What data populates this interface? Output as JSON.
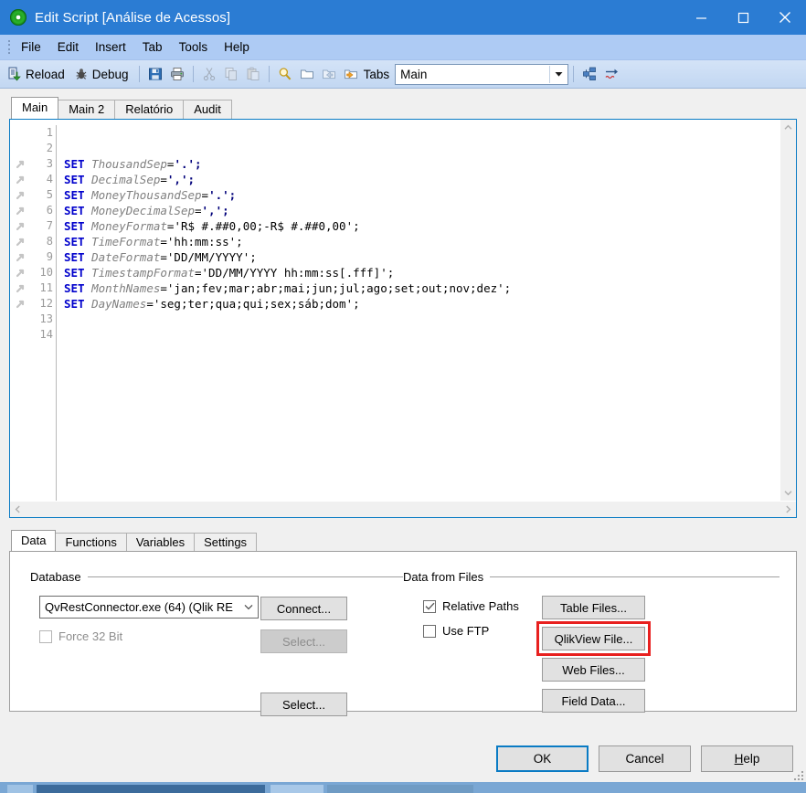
{
  "window": {
    "title": "Edit Script [Análise de Acessos]",
    "icon": "qlikview-logo-icon",
    "minimize_label": "Minimize",
    "maximize_label": "Maximize",
    "close_label": "Close"
  },
  "menubar": {
    "items": [
      {
        "label": "File"
      },
      {
        "label": "Edit"
      },
      {
        "label": "Insert"
      },
      {
        "label": "Tab"
      },
      {
        "label": "Tools"
      },
      {
        "label": "Help"
      }
    ]
  },
  "toolbar": {
    "reload_label": "Reload",
    "debug_label": "Debug",
    "tabs_label": "Tabs",
    "tab_combo_value": "Main",
    "icons": {
      "reload": "reload-icon",
      "debug": "debug-bug-icon",
      "save": "save-icon",
      "print": "print-icon",
      "cut": "cut-icon",
      "copy": "copy-icon",
      "paste": "paste-icon",
      "find": "find-icon",
      "folder": "folder-icon",
      "prev_tab": "previous-tab-icon",
      "next_tab": "next-tab-icon",
      "tab_order": "tab-order-icon",
      "goto": "goto-icon"
    }
  },
  "script_tabs": [
    {
      "label": "Main",
      "active": true
    },
    {
      "label": "Main 2",
      "active": false
    },
    {
      "label": "Relatório",
      "active": false
    },
    {
      "label": "Audit",
      "active": false
    }
  ],
  "editor": {
    "line_numbers": [
      "1",
      "2",
      "3",
      "4",
      "5",
      "6",
      "7",
      "8",
      "9",
      "10",
      "11",
      "12",
      "13",
      "14"
    ],
    "marked_lines": [
      3,
      4,
      5,
      6,
      7,
      8,
      9,
      10,
      11,
      12
    ],
    "lines": [
      {
        "n": 1,
        "text": ""
      },
      {
        "n": 2,
        "text": ""
      },
      {
        "n": 3,
        "keyword": "SET",
        "variable": "ThousandSep",
        "value": "'.';"
      },
      {
        "n": 4,
        "keyword": "SET",
        "variable": "DecimalSep",
        "value": "',';"
      },
      {
        "n": 5,
        "keyword": "SET",
        "variable": "MoneyThousandSep",
        "value": "'.';"
      },
      {
        "n": 6,
        "keyword": "SET",
        "variable": "MoneyDecimalSep",
        "value": "',';"
      },
      {
        "n": 7,
        "keyword": "SET",
        "variable": "MoneyFormat",
        "value": "'R$ #.##0,00;-R$ #.##0,00';"
      },
      {
        "n": 8,
        "keyword": "SET",
        "variable": "TimeFormat",
        "value": "'hh:mm:ss';"
      },
      {
        "n": 9,
        "keyword": "SET",
        "variable": "DateFormat",
        "value": "'DD/MM/YYYY';"
      },
      {
        "n": 10,
        "keyword": "SET",
        "variable": "TimestampFormat",
        "value": "'DD/MM/YYYY hh:mm:ss[.fff]';"
      },
      {
        "n": 11,
        "keyword": "SET",
        "variable": "MonthNames",
        "value": "'jan;fev;mar;abr;mai;jun;jul;ago;set;out;nov;dez';"
      },
      {
        "n": 12,
        "keyword": "SET",
        "variable": "DayNames",
        "value": "'seg;ter;qua;qui;sex;sáb;dom';"
      },
      {
        "n": 13,
        "text": ""
      },
      {
        "n": 14,
        "text": ""
      }
    ],
    "scroll_up_icon": "chevron-up-icon",
    "scroll_down_icon": "chevron-down-icon",
    "scroll_left_icon": "chevron-left-icon",
    "scroll_right_icon": "chevron-right-icon"
  },
  "lower_tabs": [
    {
      "label": "Data",
      "active": true
    },
    {
      "label": "Functions",
      "active": false
    },
    {
      "label": "Variables",
      "active": false
    },
    {
      "label": "Settings",
      "active": false
    }
  ],
  "database": {
    "group_label": "Database",
    "connector_value": "QvRestConnector.exe  (64) (Qlik RE",
    "force32_label": "Force 32 Bit",
    "force32_checked": false,
    "force32_disabled": true,
    "connect_label": "Connect...",
    "select_top_label": "Select...",
    "select_top_disabled": true,
    "select_bottom_label": "Select...",
    "select_bottom_disabled": false
  },
  "data_from_files": {
    "group_label": "Data from Files",
    "relative_paths_label": "Relative Paths",
    "relative_paths_checked": true,
    "use_ftp_label": "Use FTP",
    "use_ftp_checked": false,
    "buttons": [
      {
        "label": "Table Files...",
        "highlighted": false
      },
      {
        "label": "QlikView File...",
        "highlighted": true
      },
      {
        "label": "Web Files...",
        "highlighted": false
      },
      {
        "label": "Field Data...",
        "highlighted": false
      }
    ],
    "highlight_color": "#e8201f"
  },
  "footer": {
    "ok_label": "OK",
    "cancel_label": "Cancel",
    "help_label_prefix": "",
    "help_accel": "H",
    "help_label_rest": "elp"
  },
  "colors": {
    "title_bar": "#2b7cd3",
    "menu_bar": "#aecbf4",
    "toolbar_top": "#d4e3f7",
    "accent_focus": "#0a7bc4",
    "highlight_red": "#e8201f",
    "keyword_blue": "#0000cc",
    "variable_gray": "#808080",
    "string_navy": "#00007a"
  }
}
